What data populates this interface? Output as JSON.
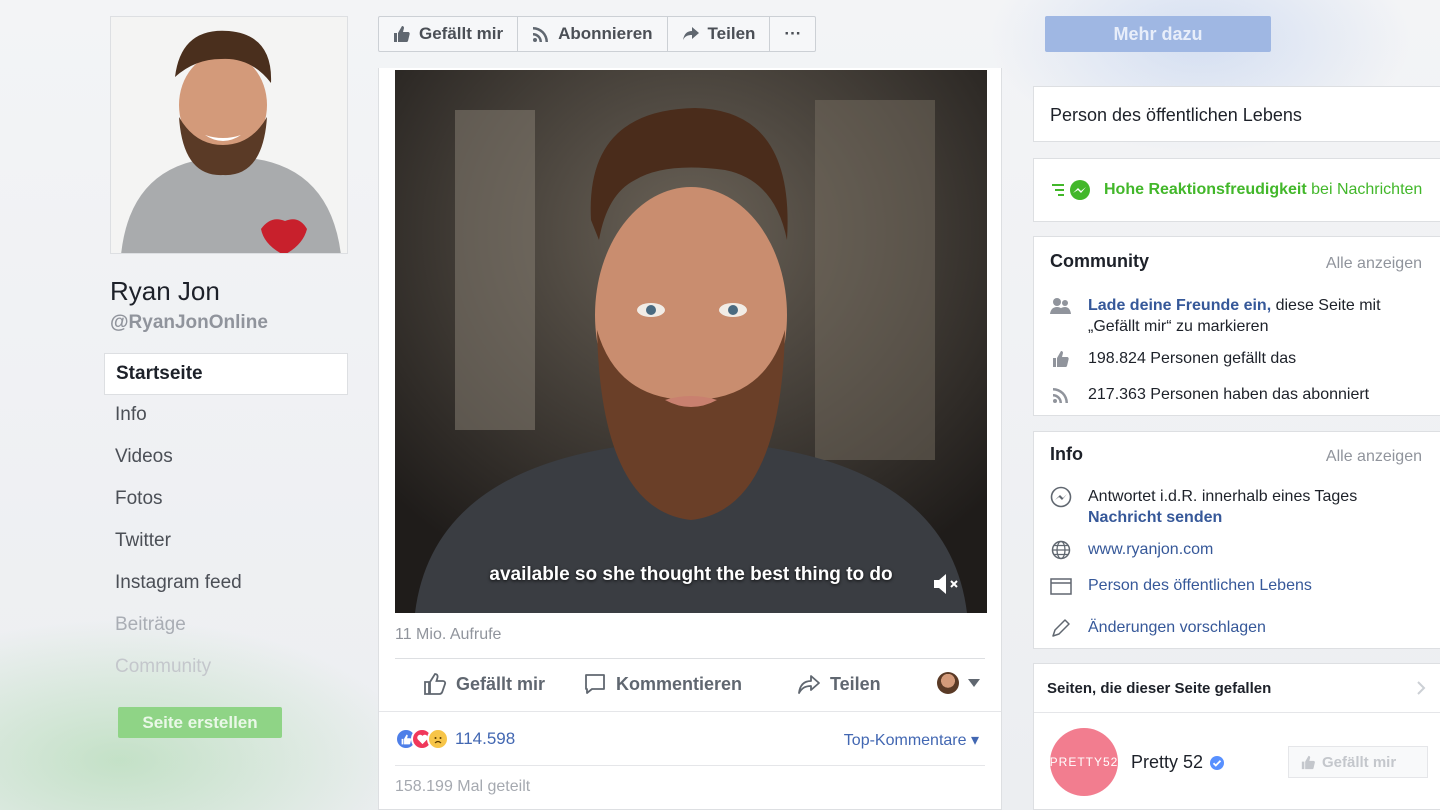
{
  "profile": {
    "name": "Ryan Jon",
    "handle": "@RyanJonOnline"
  },
  "nav": {
    "items": [
      {
        "label": "Startseite"
      },
      {
        "label": "Info"
      },
      {
        "label": "Videos"
      },
      {
        "label": "Fotos"
      },
      {
        "label": "Twitter"
      },
      {
        "label": "Instagram feed"
      },
      {
        "label": "Beiträge"
      },
      {
        "label": "Community"
      }
    ],
    "create_button": "Seite erstellen"
  },
  "topbar": {
    "like": "Gefällt mir",
    "subscribe": "Abonnieren",
    "share": "Teilen",
    "more": "···",
    "learn_more": "Mehr dazu"
  },
  "post": {
    "subtitle": "available so she thought the best thing to do",
    "views": "11 Mio. Aufrufe",
    "actions": {
      "like": "Gefällt mir",
      "comment": "Kommentieren",
      "share": "Teilen"
    },
    "reaction_count": "114.598",
    "top_comments": "Top-Kommentare ▾",
    "shares": "158.199 Mal geteilt"
  },
  "sidebar": {
    "category": "Person des öffentlichen Lebens",
    "responsiveness": {
      "strong": "Hohe Reaktionsfreudigkeit",
      "rest": " bei Nachrichten"
    },
    "community": {
      "title": "Community",
      "see_all": "Alle anzeigen",
      "invite_link": "Lade deine Freunde ein,",
      "invite_rest": " diese Seite mit „Gefällt mir“ zu markieren",
      "likes": "198.824 Personen gefällt das",
      "followers": "217.363 Personen haben das abonniert"
    },
    "info": {
      "title": "Info",
      "see_all": "Alle anzeigen",
      "response_time": "Antwortet i.d.R. innerhalb eines Tages",
      "send_message": "Nachricht senden",
      "website": "www.ryanjon.com",
      "category": "Person des öffentlichen Lebens",
      "suggest_edits": "Änderungen vorschlagen"
    },
    "liked_pages": {
      "title": "Seiten, die dieser Seite gefallen",
      "page_name": "Pretty 52",
      "avatar_text": "PRETTY52",
      "like_button": "Gefällt mir"
    }
  },
  "colors": {
    "fb_blue": "#4267b2",
    "messenger_green": "#42b72a",
    "create_green": "#8fd486"
  }
}
